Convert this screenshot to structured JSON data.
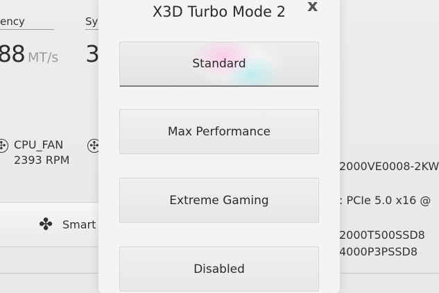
{
  "background": {
    "freq_label": "ency",
    "sys_label": "Sy",
    "freq_value": "88",
    "freq_unit": "MT/s",
    "sys_value": "3",
    "fans": [
      {
        "name": "CPU_FAN",
        "rpm": "2393 RPM"
      }
    ],
    "smart_button_label": "Smart",
    "right_lines": [
      "2000VE0008-2KW",
      ": PCIe 5.0 x16 @",
      "2000T500SSD8",
      "4000P3PSSD8"
    ]
  },
  "modal": {
    "title": "X3D Turbo Mode 2",
    "close_icon": "x",
    "options": [
      {
        "label": "Standard",
        "selected": true
      },
      {
        "label": "Max Performance",
        "selected": false
      },
      {
        "label": "Extreme Gaming",
        "selected": false
      },
      {
        "label": "Disabled",
        "selected": false
      }
    ]
  }
}
